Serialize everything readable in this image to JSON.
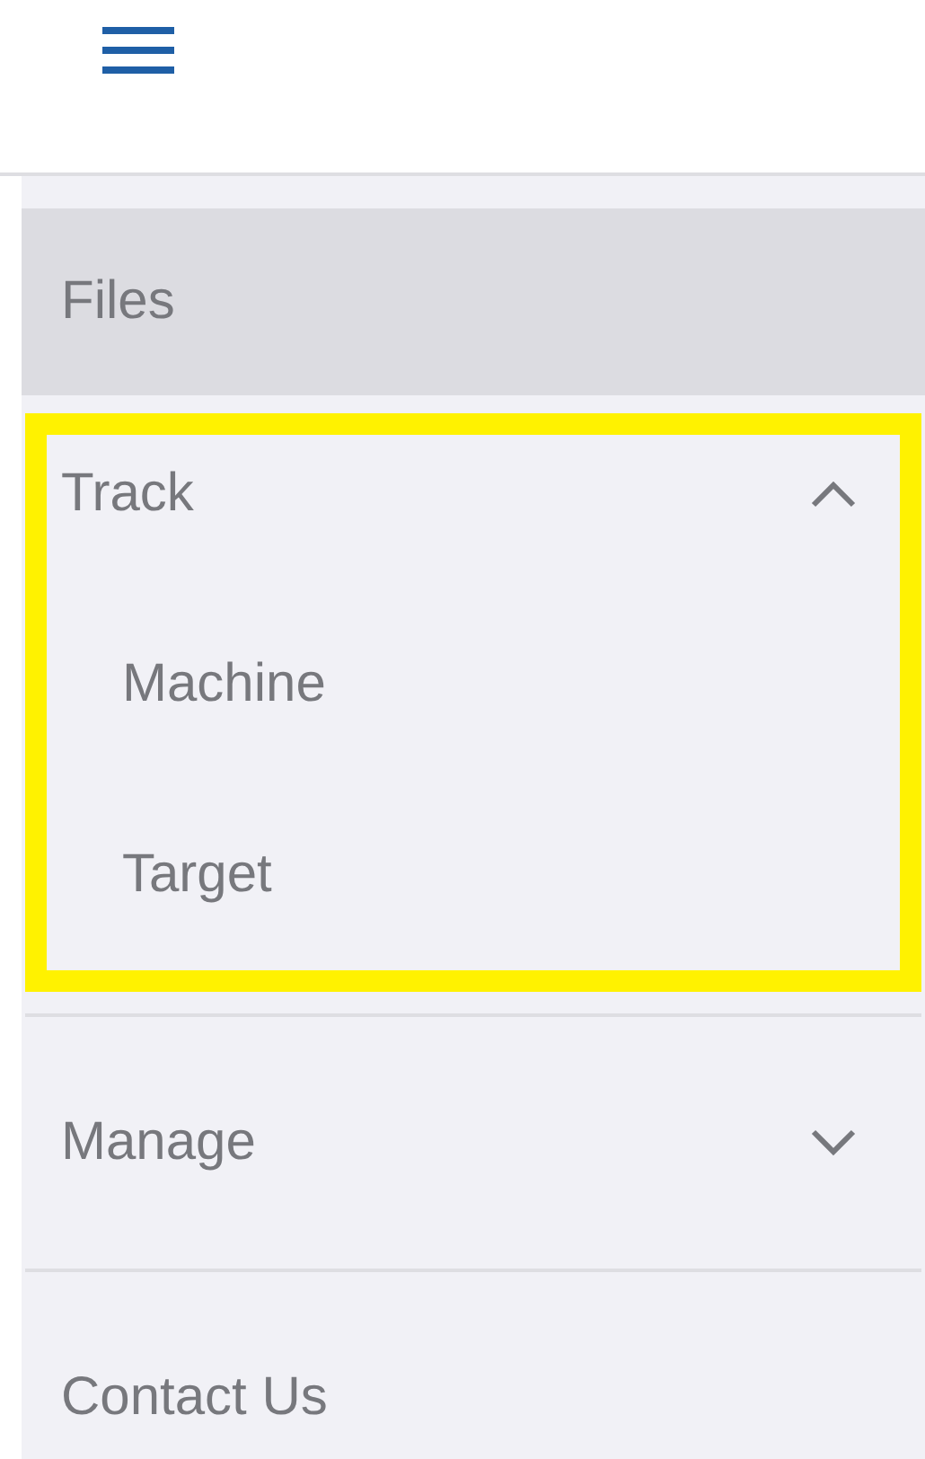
{
  "menu_button": {
    "kind": "hamburger"
  },
  "nav": {
    "items": [
      {
        "label": "Files",
        "kind": "link",
        "selected": true
      },
      {
        "label": "Track",
        "kind": "group",
        "selected": false,
        "expanded": true,
        "highlighted": true,
        "children": [
          {
            "label": "Machine",
            "selected": false
          },
          {
            "label": "Target",
            "selected": false
          }
        ]
      },
      {
        "label": "Manage",
        "kind": "group",
        "selected": false,
        "expanded": false,
        "highlighted": false
      },
      {
        "label": "Contact Us",
        "kind": "link",
        "selected": false
      }
    ]
  }
}
